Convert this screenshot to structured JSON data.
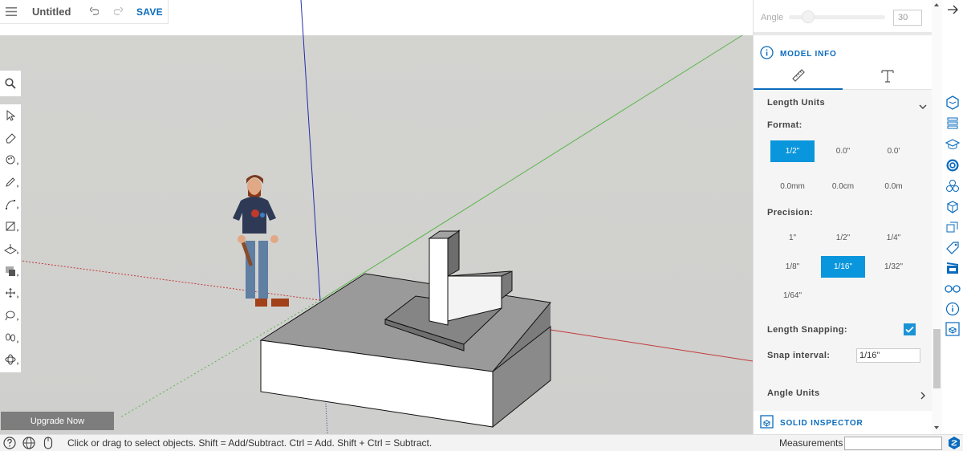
{
  "app": {
    "title": "Untitled",
    "save_label": "SAVE"
  },
  "colors": {
    "accent": "#0a6bbd",
    "selected": "#0a96dc",
    "axis_green": "#5ab54a",
    "axis_red": "#c23a3a",
    "axis_blue": "#2330a8"
  },
  "left_toolbar": {
    "search": "search-icon",
    "tools": [
      "select-icon",
      "eraser-icon",
      "paint-bucket-icon",
      "pencil-icon",
      "arc-icon",
      "rectangle-icon",
      "push-pull-icon",
      "offset-icon",
      "move-icon",
      "tape-measure-icon",
      "walk-icon",
      "orbit-icon"
    ]
  },
  "upgrade": {
    "label": "Upgrade Now"
  },
  "status_bar": {
    "hint": "Click or drag to select objects. Shift = Add/Subtract. Ctrl = Add. Shift + Ctrl = Subtract.",
    "measurements_label": "Measurements",
    "measurements_value": ""
  },
  "panel": {
    "angle": {
      "label": "Angle",
      "value": "30"
    },
    "model_info": {
      "title": "MODEL INFO",
      "tabs": [
        {
          "name": "units",
          "icon": "ruler-icon",
          "active": true
        },
        {
          "name": "text",
          "icon": "text-icon",
          "active": false
        }
      ],
      "length_units": {
        "title": "Length Units",
        "format_label": "Format:",
        "format_options": [
          {
            "label": "1/2\"",
            "selected": true
          },
          {
            "label": "0.0\"",
            "selected": false
          },
          {
            "label": "0.0'",
            "selected": false
          },
          {
            "label": "0.0mm",
            "selected": false
          },
          {
            "label": "0.0cm",
            "selected": false
          },
          {
            "label": "0.0m",
            "selected": false
          }
        ],
        "precision_label": "Precision:",
        "precision_options": [
          {
            "label": "1\"",
            "selected": false
          },
          {
            "label": "1/2\"",
            "selected": false
          },
          {
            "label": "1/4\"",
            "selected": false
          },
          {
            "label": "1/8\"",
            "selected": false
          },
          {
            "label": "1/16\"",
            "selected": true
          },
          {
            "label": "1/32\"",
            "selected": false
          },
          {
            "label": "1/64\"",
            "selected": false
          }
        ],
        "snapping_label": "Length Snapping:",
        "snapping_checked": true,
        "snap_interval_label": "Snap interval:",
        "snap_interval_value": "1/16\""
      },
      "angle_units_title": "Angle Units"
    },
    "solid_inspector": {
      "title": "SOLID INSPECTOR"
    }
  },
  "right_strip": {
    "icons": [
      "3d-warehouse-icon",
      "layers-icon",
      "instructor-icon",
      "materials-icon",
      "components-icon",
      "entity-info-icon",
      "outliner-icon",
      "styles-icon",
      "tags-icon",
      "scenes-icon",
      "views-icon",
      "info-icon",
      "solid-inspector-icon"
    ]
  }
}
